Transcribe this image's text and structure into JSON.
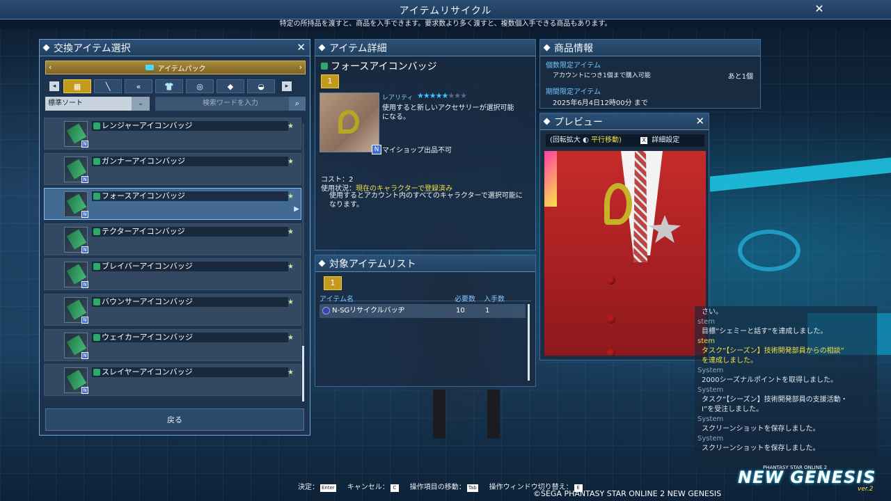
{
  "topbar": {
    "title": "アイテムリサイクル",
    "close": "✕",
    "subtitle": "特定の所持品を渡すと、商品を入手できます。要求数より多く渡すと、複数個入手できる商品もあります。"
  },
  "left_panel": {
    "title": "交換アイテム選択",
    "close": "✕",
    "bag_label": "アイテムパック",
    "sort_label": "標準ソート",
    "search_placeholder": "検索ワードを入力",
    "category_tabs": [
      {
        "icon": "grid-icon",
        "active": true
      },
      {
        "icon": "sword-icon",
        "active": false
      },
      {
        "icon": "double-chevron-icon",
        "active": false
      },
      {
        "icon": "shirt-icon",
        "active": false
      },
      {
        "icon": "ring-icon",
        "active": false
      },
      {
        "icon": "diamond-icon",
        "active": false
      },
      {
        "icon": "pot-icon",
        "active": false
      }
    ],
    "items": [
      {
        "name": "レンジャーアイコンバッジ",
        "selected": false
      },
      {
        "name": "ガンナーアイコンバッジ",
        "selected": false
      },
      {
        "name": "フォースアイコンバッジ",
        "selected": true
      },
      {
        "name": "テクターアイコンバッジ",
        "selected": false
      },
      {
        "name": "ブレイバーアイコンバッジ",
        "selected": false
      },
      {
        "name": "バウンサーアイコンバッジ",
        "selected": false
      },
      {
        "name": "ウェイカーアイコンバッジ",
        "selected": false
      },
      {
        "name": "スレイヤーアイコンバッジ",
        "selected": false
      }
    ],
    "back_label": "戻る"
  },
  "detail": {
    "title": "アイテム詳細",
    "item_name": "フォースアイコンバッジ",
    "quantity": "1",
    "rarity_label": "レアリティ",
    "rarity": 5,
    "rarity_max": 8,
    "description": "使用すると新しいアクセサリーが選択可能になる。",
    "myshop": "マイショップ出品不可",
    "cost": "コスト：2",
    "usage_prefix": "使用状況：",
    "usage_status": "現在のキャラクターで登録済み",
    "usage_note": "使用するとアカウント内のすべてのキャラクターで選択可能になります。"
  },
  "target_list": {
    "title": "対象アイテムリスト",
    "quantity": "1",
    "headers": {
      "name": "アイテム名",
      "required": "必要数",
      "obtain": "入手数"
    },
    "rows": [
      {
        "name": "N-SGリサイクルバッヂ",
        "required": "10",
        "obtain": "1"
      }
    ]
  },
  "product_info": {
    "title": "商品情報",
    "limit_label": "個数限定アイテム",
    "limit_desc": "アカウントにつき1個まで購入可能",
    "limit_remaining": "あと1個",
    "period_label": "期間限定アイテム",
    "period_value": "2025年6月4日12時00分 まで"
  },
  "preview": {
    "title": "プレビュー",
    "close": "✕",
    "controls_prefix": "(回転拡大",
    "controls_move": "平行移動)",
    "x_key": "X",
    "detail_settings": "詳細設定"
  },
  "chat": [
    {
      "type": "text",
      "text": "さい。"
    },
    {
      "type": "sys",
      "text": "stem"
    },
    {
      "type": "text",
      "text": "目標“シェミーと話す”を達成しました。"
    },
    {
      "type": "sys-hl",
      "text": "stem"
    },
    {
      "type": "hl",
      "text": "タスク“【シーズン】技術開発部員からの相談”"
    },
    {
      "type": "hl",
      "text": "を達成しました。"
    },
    {
      "type": "sys",
      "text": "System"
    },
    {
      "type": "text",
      "text": "2000シーズナルポイントを取得しました。"
    },
    {
      "type": "sys",
      "text": "System"
    },
    {
      "type": "text",
      "text": "タスク“【シーズン】技術開発部員の支援活動・"
    },
    {
      "type": "text",
      "text": "Ⅰ”を受注しました。"
    },
    {
      "type": "sys",
      "text": "System"
    },
    {
      "type": "text",
      "text": "スクリーンショットを保存しました。"
    },
    {
      "type": "sys",
      "text": "System"
    },
    {
      "type": "text",
      "text": "スクリーンショットを保存しました。"
    }
  ],
  "help": {
    "confirm": "決定：",
    "confirm_key": "Enter",
    "cancel": "キャンセル：",
    "cancel_key": "C",
    "move": "操作項目の移動：",
    "move_key": "Tab",
    "switch": "操作ウィンドウ切り替え：",
    "switch_key": "E"
  },
  "footer": {
    "copyright": "©SEGA PHANTASY STAR ONLINE 2 NEW GENESIS",
    "logo_small": "PHANTASY STAR ONLINE 2",
    "logo": "NEW GENESIS",
    "logo_ver": "ver.2"
  },
  "colors": {
    "accent_gold": "#c49a1c",
    "highlight_yellow": "#f0e04a",
    "label_blue": "#6ec6ff"
  }
}
